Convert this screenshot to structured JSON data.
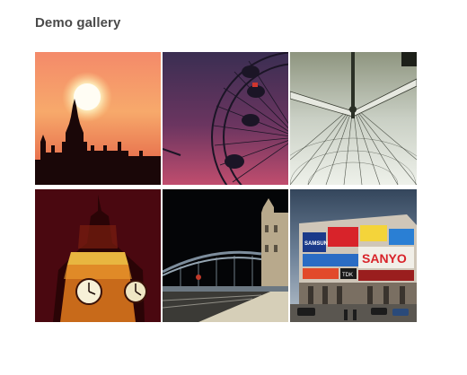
{
  "gallery": {
    "title": "Demo gallery",
    "images": [
      {
        "name": "sunset-westminster-silhouette",
        "subject": "Westminster skyline silhouette at sunset",
        "colors": [
          "#f7a05c",
          "#e8584a",
          "#2a0d10"
        ]
      },
      {
        "name": "london-eye-dusk",
        "subject": "London Eye wheel against purple dusk sky",
        "colors": [
          "#3a2a55",
          "#b4446a",
          "#1a1524"
        ]
      },
      {
        "name": "london-eye-underside",
        "subject": "Looking up through the London Eye spokes",
        "colors": [
          "#9aa391",
          "#e6ebe2",
          "#3b3f35"
        ]
      },
      {
        "name": "big-ben-night",
        "subject": "Big Ben clock tower lit at night",
        "colors": [
          "#5a0a12",
          "#ffb43a",
          "#2a0408"
        ]
      },
      {
        "name": "tower-bridge-night",
        "subject": "Tower Bridge at night",
        "colors": [
          "#050608",
          "#b9b6a8",
          "#6d7a86"
        ]
      },
      {
        "name": "piccadilly-circus",
        "subject": "Piccadilly Circus billboards",
        "colors": [
          "#2f4a66",
          "#d8232a",
          "#f2e04a"
        ]
      }
    ],
    "billboard_text": [
      "SAMSUNG",
      "SANYO",
      "TDK"
    ]
  }
}
